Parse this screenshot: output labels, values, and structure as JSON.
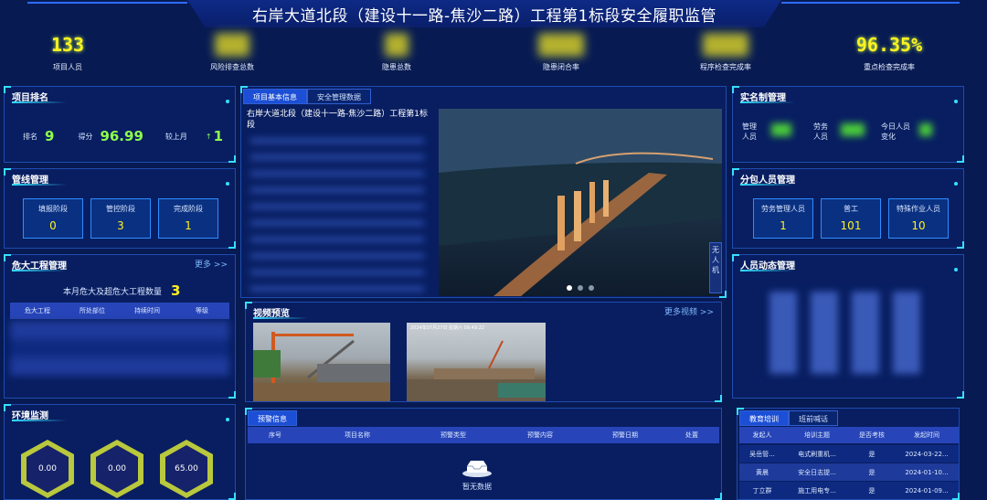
{
  "header": {
    "title": "右岸大道北段（建设十一路-焦沙二路）工程第1标段安全履职监管"
  },
  "kpis": [
    {
      "value": "133",
      "label": "项目人员",
      "obscured": false
    },
    {
      "value": "",
      "label": "风险排查总数",
      "obscured": true
    },
    {
      "value": "",
      "label": "隐患总数",
      "obscured": true
    },
    {
      "value": "",
      "label": "隐患闭合率",
      "obscured": true
    },
    {
      "value": "",
      "label": "程序检查完成率",
      "obscured": true
    },
    {
      "value": "96.35%",
      "label": "重点检查完成率",
      "obscured": false
    }
  ],
  "ranking": {
    "title": "项目排名",
    "rank_label": "排名",
    "rank_value": "9",
    "score_label": "得分",
    "score_value": "96.99",
    "compare_label": "较上月",
    "compare_arrow": "↑",
    "compare_value": "1"
  },
  "pipeline": {
    "title": "管线管理",
    "boxes": [
      {
        "label": "填报阶段",
        "value": "0"
      },
      {
        "label": "管控阶段",
        "value": "3"
      },
      {
        "label": "完成阶段",
        "value": "1"
      }
    ]
  },
  "danger": {
    "title": "危大工程管理",
    "more": "更多 >>",
    "count_label": "本月危大及超危大工程数量",
    "count_value": "3",
    "columns": [
      "危大工程",
      "所处部位",
      "持续时间",
      "等级"
    ]
  },
  "env": {
    "title": "环境监测",
    "values": [
      "0.00",
      "0.00",
      "65.00"
    ]
  },
  "center_tabs": {
    "tab1": "项目基本信息",
    "tab2": "安全管理数据"
  },
  "project_info": {
    "name": "右岸大道北段（建设十一路-焦沙二路）工程第1标段"
  },
  "drone_label": "无人机",
  "video": {
    "title": "视频预览",
    "more": "更多视频 >>",
    "cam2_caption": "2024年07月27日 星期六 09:49:22"
  },
  "warnings": {
    "tab": "预警信息",
    "columns": [
      "序号",
      "项目名称",
      "预警类型",
      "预警内容",
      "预警日期",
      "处置"
    ],
    "empty_text": "暂无数据"
  },
  "realname": {
    "title": "实名制管理",
    "items": [
      {
        "label": "管理人员"
      },
      {
        "label": "劳务人员"
      },
      {
        "label": "今日人员变化"
      }
    ]
  },
  "subcontract": {
    "title": "分包人员管理",
    "boxes": [
      {
        "label": "劳务管理人员",
        "value": "1"
      },
      {
        "label": "普工",
        "value": "101"
      },
      {
        "label": "特殊作业人员",
        "value": "10"
      }
    ]
  },
  "dynamic": {
    "title": "人员动态管理"
  },
  "training": {
    "tab1": "教育培训",
    "tab2": "班前喊话",
    "columns": [
      "发起人",
      "培训主题",
      "是否考核",
      "发起时间"
    ],
    "rows": [
      [
        "吴岳管...",
        "电式刷重机...",
        "是",
        "2024-03-22..."
      ],
      [
        "黄晨",
        "安全日志提...",
        "是",
        "2024-01-10..."
      ],
      [
        "丁立群",
        "施工用电专...",
        "是",
        "2024-01-09..."
      ]
    ]
  },
  "colors": {
    "accent": "#36e0ff",
    "kpi": "#fff21f",
    "bg": "#071a52"
  }
}
